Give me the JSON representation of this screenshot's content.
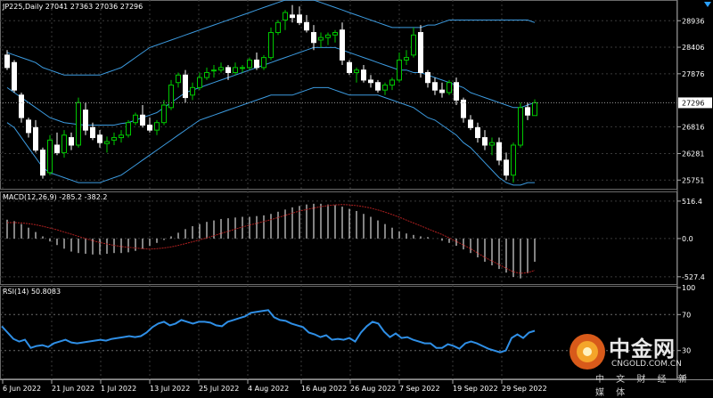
{
  "header": {
    "symbol_label": "JP225,Daily",
    "ohlc_label": "27041 27363 27036 27296"
  },
  "macd": {
    "label": "MACD(12,26,9) -285.2 -382.2"
  },
  "rsi": {
    "label": "RSI(14) 50.8083"
  },
  "watermark": {
    "name": "中金网",
    "url": "CNGOLD.COM.CN",
    "sub": "中 文 财 经 新 媒 体"
  },
  "colors": {
    "background": "#000000",
    "grid": "#3a3a3a",
    "bullish_candle": "#00c800",
    "bearish_candle": "#ffffff",
    "bollinger": "#3c9be0",
    "macd_hist": "#d9d9d9",
    "macd_signal": "#b02020",
    "rsi_line": "#2f8fe6"
  },
  "chart_data": [
    {
      "type": "candlestick",
      "title": "JP225,Daily",
      "y_ticks": [
        28936,
        28406,
        27876,
        26816,
        26281,
        25751
      ],
      "current_price_label": "27296",
      "ylim": [
        25560,
        29350
      ],
      "x_tick_labels": [
        "6 Jun 2022",
        "21 Jun 2022",
        "1 Jul 2022",
        "13 Jul 2022",
        "25 Jul 2022",
        "4 Aug 2022",
        "16 Aug 2022",
        "26 Aug 2022",
        "7 Sep 2022",
        "19 Sep 2022",
        "29 Sep 2022"
      ],
      "candles": [
        [
          28250,
          28350,
          27950,
          28000
        ],
        [
          28100,
          28150,
          27500,
          27550
        ],
        [
          27450,
          27500,
          26900,
          27000
        ],
        [
          26950,
          27000,
          26600,
          26700
        ],
        [
          26800,
          26950,
          26300,
          26350
        ],
        [
          26350,
          26400,
          25780,
          25850
        ],
        [
          25900,
          26650,
          25850,
          26550
        ],
        [
          26450,
          26700,
          26250,
          26300
        ],
        [
          26300,
          26750,
          26200,
          26650
        ],
        [
          26600,
          26700,
          26350,
          26450
        ],
        [
          26450,
          27400,
          26400,
          27300
        ],
        [
          27150,
          27300,
          26650,
          26750
        ],
        [
          26800,
          26900,
          26550,
          26600
        ],
        [
          26650,
          26750,
          26400,
          26500
        ],
        [
          26480,
          26620,
          26300,
          26520
        ],
        [
          26550,
          26700,
          26450,
          26600
        ],
        [
          26600,
          26750,
          26500,
          26650
        ],
        [
          26650,
          26950,
          26600,
          26900
        ],
        [
          26900,
          27100,
          26850,
          27050
        ],
        [
          27050,
          27250,
          26800,
          26850
        ],
        [
          26850,
          27000,
          26700,
          26750
        ],
        [
          26750,
          26950,
          26650,
          26900
        ],
        [
          26900,
          27350,
          26850,
          27250
        ],
        [
          27200,
          27750,
          27150,
          27650
        ],
        [
          27700,
          27900,
          27600,
          27850
        ],
        [
          27850,
          27950,
          27300,
          27400
        ],
        [
          27450,
          27700,
          27350,
          27600
        ],
        [
          27600,
          27900,
          27550,
          27800
        ],
        [
          27800,
          28000,
          27750,
          27900
        ],
        [
          27950,
          28050,
          27800,
          27950
        ],
        [
          27950,
          28100,
          27900,
          28000
        ],
        [
          28000,
          28050,
          27750,
          27900
        ],
        [
          27900,
          28100,
          27850,
          28000
        ],
        [
          28000,
          28050,
          27900,
          28000
        ],
        [
          28000,
          28200,
          27950,
          28150
        ],
        [
          28150,
          28300,
          27950,
          28000
        ],
        [
          28000,
          28250,
          27950,
          28200
        ],
        [
          28200,
          28800,
          28150,
          28700
        ],
        [
          28700,
          28950,
          28650,
          28900
        ],
        [
          28950,
          29150,
          28750,
          29100
        ],
        [
          29050,
          29250,
          28900,
          29000
        ],
        [
          29050,
          29220,
          28850,
          28900
        ],
        [
          28900,
          29050,
          28700,
          28750
        ],
        [
          28700,
          28850,
          28350,
          28500
        ],
        [
          28550,
          28700,
          28400,
          28600
        ],
        [
          28600,
          28700,
          28450,
          28650
        ],
        [
          28650,
          28750,
          28500,
          28700
        ],
        [
          28750,
          28900,
          28050,
          28150
        ],
        [
          28100,
          28150,
          27850,
          27900
        ],
        [
          27900,
          28000,
          27700,
          27950
        ],
        [
          27950,
          28050,
          27700,
          27750
        ],
        [
          27750,
          27850,
          27600,
          27700
        ],
        [
          27700,
          27750,
          27500,
          27550
        ],
        [
          27550,
          27700,
          27450,
          27650
        ],
        [
          27650,
          27800,
          27550,
          27750
        ],
        [
          27750,
          28300,
          27700,
          28150
        ],
        [
          28150,
          28350,
          28050,
          28200
        ],
        [
          28250,
          28800,
          28200,
          28650
        ],
        [
          28700,
          28850,
          27800,
          27900
        ],
        [
          27900,
          27950,
          27600,
          27700
        ],
        [
          27700,
          27800,
          27450,
          27550
        ],
        [
          27550,
          27700,
          27400,
          27500
        ],
        [
          27500,
          27750,
          27450,
          27700
        ],
        [
          27700,
          27800,
          27250,
          27350
        ],
        [
          27350,
          27400,
          26900,
          27000
        ],
        [
          26950,
          27050,
          26750,
          26800
        ],
        [
          26800,
          26900,
          26500,
          26600
        ],
        [
          26600,
          26750,
          26350,
          26450
        ],
        [
          26450,
          26600,
          26250,
          26500
        ],
        [
          26500,
          26600,
          26050,
          26150
        ],
        [
          26150,
          26300,
          25750,
          25850
        ],
        [
          25850,
          26500,
          25700,
          26450
        ],
        [
          26450,
          27300,
          26400,
          27200
        ],
        [
          27200,
          27300,
          26950,
          27050
        ],
        [
          27041,
          27363,
          27036,
          27296
        ]
      ],
      "bollinger": {
        "upper": [
          28300,
          28250,
          28200,
          28150,
          28100,
          28000,
          27950,
          27900,
          27850,
          27850,
          27850,
          27850,
          27850,
          27850,
          27900,
          27950,
          28000,
          28100,
          28200,
          28300,
          28400,
          28450,
          28500,
          28550,
          28600,
          28650,
          28700,
          28750,
          28800,
          28850,
          28900,
          28950,
          29000,
          29050,
          29100,
          29150,
          29200,
          29250,
          29300,
          29350,
          29350,
          29350,
          29350,
          29350,
          29300,
          29250,
          29200,
          29150,
          29100,
          29050,
          29000,
          28950,
          28900,
          28850,
          28800,
          28800,
          28800,
          28800,
          28800,
          28850,
          28850,
          28900,
          28950,
          28950,
          28950,
          28950,
          28950,
          28950,
          28950,
          28950,
          28950,
          28950,
          28950,
          28950,
          28900
        ],
        "middle": [
          27600,
          27500,
          27400,
          27300,
          27200,
          27100,
          27000,
          26950,
          26900,
          26880,
          26860,
          26850,
          26850,
          26850,
          26850,
          26850,
          26880,
          26900,
          26950,
          27000,
          27050,
          27100,
          27200,
          27300,
          27400,
          27500,
          27550,
          27600,
          27650,
          27700,
          27750,
          27800,
          27850,
          27900,
          27950,
          28000,
          28050,
          28100,
          28150,
          28200,
          28250,
          28300,
          28350,
          28400,
          28400,
          28400,
          28400,
          28350,
          28300,
          28250,
          28200,
          28150,
          28100,
          28050,
          28000,
          27950,
          27950,
          27900,
          27900,
          27850,
          27800,
          27750,
          27700,
          27650,
          27600,
          27500,
          27450,
          27400,
          27350,
          27300,
          27250,
          27200,
          27200,
          27250,
          27300
        ],
        "lower": [
          26900,
          26800,
          26600,
          26400,
          26200,
          26000,
          25900,
          25850,
          25800,
          25750,
          25700,
          25700,
          25700,
          25700,
          25750,
          25800,
          25850,
          25950,
          26050,
          26150,
          26250,
          26350,
          26450,
          26550,
          26650,
          26750,
          26850,
          26950,
          27000,
          27050,
          27100,
          27150,
          27200,
          27250,
          27300,
          27350,
          27400,
          27450,
          27450,
          27450,
          27450,
          27500,
          27550,
          27600,
          27600,
          27600,
          27550,
          27500,
          27450,
          27450,
          27450,
          27450,
          27450,
          27400,
          27350,
          27300,
          27250,
          27200,
          27100,
          27000,
          26950,
          26850,
          26750,
          26650,
          26500,
          26400,
          26250,
          26100,
          25950,
          25800,
          25700,
          25650,
          25650,
          25700,
          25700
        ]
      }
    },
    {
      "type": "macd",
      "title": "MACD(12,26,9) -285.2 -382.2",
      "y_ticks": [
        516.4,
        0.0,
        -527.4
      ],
      "ylim": [
        -640,
        650
      ],
      "histogram": [
        260,
        240,
        200,
        150,
        90,
        30,
        -40,
        -90,
        -140,
        -180,
        -200,
        -210,
        -220,
        -220,
        -210,
        -200,
        -200,
        -190,
        -170,
        -140,
        -100,
        -60,
        -20,
        30,
        80,
        130,
        170,
        200,
        230,
        250,
        270,
        280,
        290,
        300,
        300,
        310,
        320,
        340,
        370,
        400,
        430,
        450,
        470,
        480,
        480,
        470,
        460,
        440,
        410,
        380,
        340,
        300,
        250,
        200,
        150,
        100,
        70,
        50,
        30,
        20,
        0,
        -30,
        -60,
        -100,
        -150,
        -200,
        -260,
        -320,
        -370,
        -420,
        -470,
        -530,
        -550,
        -480,
        -320
      ],
      "signal": [
        220,
        220,
        215,
        205,
        190,
        170,
        145,
        120,
        90,
        60,
        30,
        0,
        -30,
        -55,
        -75,
        -95,
        -110,
        -120,
        -130,
        -140,
        -145,
        -140,
        -130,
        -115,
        -95,
        -70,
        -45,
        -20,
        10,
        40,
        70,
        100,
        130,
        160,
        185,
        210,
        235,
        260,
        290,
        320,
        350,
        380,
        400,
        420,
        440,
        455,
        465,
        470,
        465,
        455,
        440,
        420,
        395,
        365,
        330,
        295,
        255,
        215,
        175,
        135,
        95,
        55,
        10,
        -40,
        -90,
        -140,
        -200,
        -260,
        -310,
        -360,
        -410,
        -460,
        -480,
        -470,
        -440
      ]
    },
    {
      "type": "line",
      "title": "RSI(14) 50.8083",
      "y_ticks": [
        100,
        70,
        30,
        0
      ],
      "ylim": [
        0,
        100
      ],
      "values": [
        57,
        50,
        43,
        40,
        42,
        33,
        35,
        36,
        34,
        38,
        40,
        42,
        39,
        38,
        39,
        40,
        41,
        42,
        41,
        43,
        44,
        45,
        46,
        45,
        46,
        50,
        56,
        60,
        62,
        58,
        60,
        64,
        62,
        60,
        62,
        62,
        61,
        58,
        57,
        62,
        64,
        66,
        68,
        72,
        73,
        74,
        75,
        67,
        64,
        63,
        60,
        58,
        56,
        50,
        48,
        45,
        47,
        42,
        43,
        42,
        44,
        40,
        50,
        57,
        62,
        60,
        51,
        45,
        49,
        44,
        45,
        42,
        40,
        38,
        38,
        33,
        33,
        37,
        35,
        32,
        38,
        40,
        38,
        35,
        32,
        30,
        28,
        30,
        44,
        48,
        44,
        50,
        52
      ]
    }
  ]
}
